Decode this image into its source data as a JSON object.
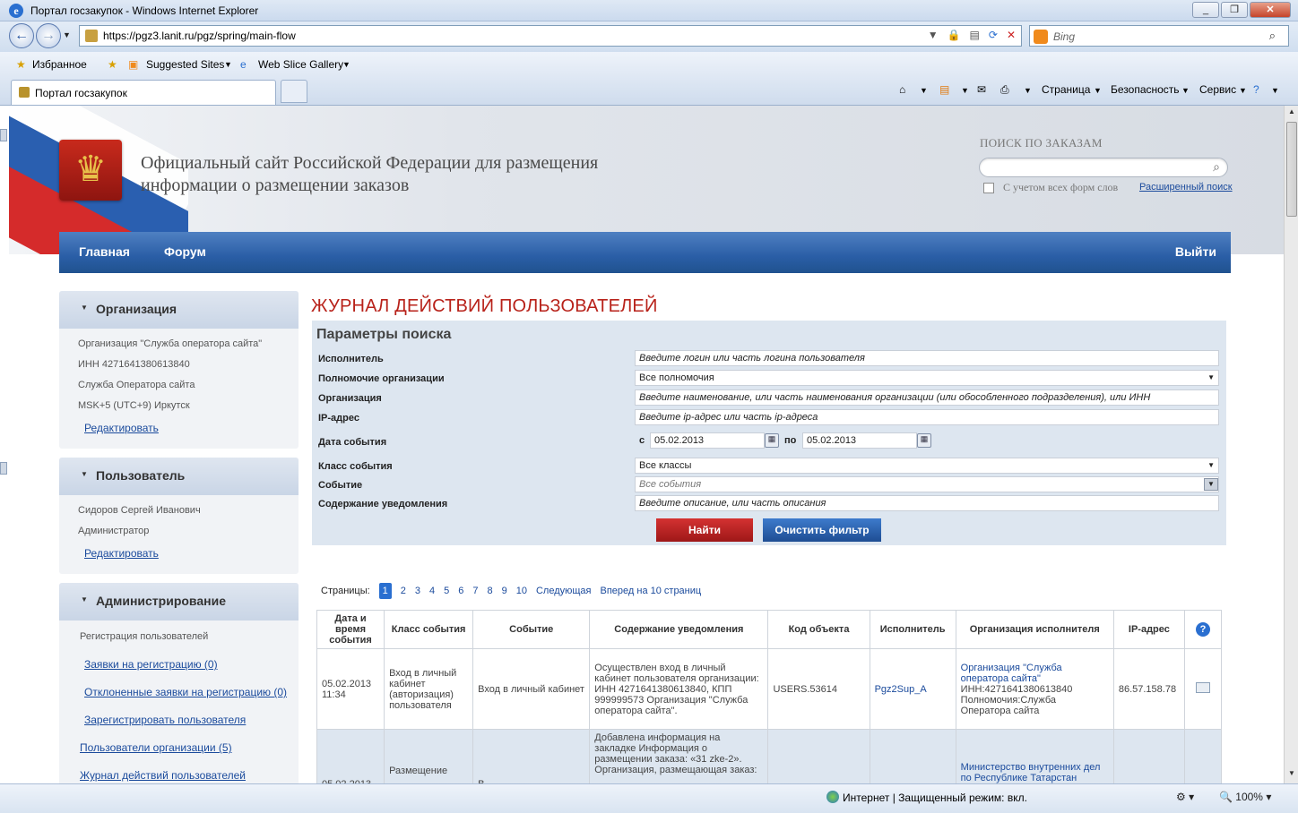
{
  "browser": {
    "window_title": "Портал госзакупок - Windows Internet Explorer",
    "url": "https://pgz3.lanit.ru/pgz/spring/main-flow",
    "search_placeholder": "Bing",
    "favorites_label": "Избранное",
    "fav_items": [
      "Suggested Sites",
      "Web Slice Gallery"
    ],
    "tab_title": "Портал госзакупок",
    "commands": [
      "Страница",
      "Безопасность",
      "Сервис"
    ],
    "status_text": "Интернет | Защищенный режим: вкл.",
    "zoom": "100%"
  },
  "site": {
    "title_line1": "Официальный сайт Российской Федерации для размещения",
    "title_line2": "информации о размещении заказов",
    "search_label": "ПОИСК ПО ЗАКАЗАМ",
    "search_checkbox_label": "С учетом всех форм слов",
    "advanced_search": "Расширенный поиск",
    "nav": {
      "home": "Главная",
      "forum": "Форум",
      "logout": "Выйти"
    }
  },
  "sidebar": {
    "org": {
      "title": "Организация",
      "lines": [
        "Организация \"Служба оператора сайта\"",
        "ИНН 4271641380613840",
        "Служба Оператора сайта",
        "MSK+5 (UTC+9) Иркутск"
      ],
      "edit": "Редактировать"
    },
    "user": {
      "title": "Пользователь",
      "lines": [
        "Сидоров Сергей Иванович",
        "Администратор"
      ],
      "edit": "Редактировать"
    },
    "admin": {
      "title": "Администрирование",
      "section": "Регистрация пользователей",
      "links": [
        "Заявки на регистрацию (0)",
        "Отклоненные заявки на регистрацию (0)",
        "Зарегистрировать пользователя"
      ],
      "links2": [
        "Пользователи организации (5)",
        "Журнал действий пользователей"
      ]
    }
  },
  "main": {
    "title": "ЖУРНАЛ ДЕЙСТВИЙ ПОЛЬЗОВАТЕЛЕЙ",
    "params_title": "Параметры поиска",
    "fields": {
      "executor": {
        "label": "Исполнитель",
        "placeholder": "Введите логин или часть логина пользователя"
      },
      "authority": {
        "label": "Полномочие организации",
        "value": "Все полномочия"
      },
      "organization": {
        "label": "Организация",
        "placeholder": "Введите наименование, или часть наименования организации (или обособленного подразделения), или ИНН"
      },
      "ip": {
        "label": "IP-адрес",
        "placeholder": "Введите ip-адрес или часть ip-адреса"
      },
      "date": {
        "label": "Дата события",
        "from_label": "с",
        "from": "05.02.2013",
        "to_label": "по",
        "to": "05.02.2013"
      },
      "event_class": {
        "label": "Класс события",
        "value": "Все классы"
      },
      "event": {
        "label": "Событие",
        "placeholder": "Все события"
      },
      "content": {
        "label": "Содержание уведомления",
        "placeholder": "Введите описание, или часть описания"
      }
    },
    "find_button": "Найти",
    "clear_button": "Очистить фильтр",
    "pager": {
      "label": "Страницы:",
      "pages": [
        "1",
        "2",
        "3",
        "4",
        "5",
        "6",
        "7",
        "8",
        "9",
        "10"
      ],
      "next": "Следующая",
      "forward": "Вперед на 10 страниц"
    },
    "table": {
      "headers": [
        "Дата и время события",
        "Класс события",
        "Событие",
        "Содержание уведомления",
        "Код объекта",
        "Исполнитель",
        "Организация исполнителя",
        "IP-адрес"
      ],
      "rows": [
        {
          "datetime": "05.02.2013 11:34",
          "class": "Вход в личный кабинет (авторизация) пользователя",
          "event": "Вход в личный кабинет",
          "content": "Осуществлен вход в личный кабинет пользователя организации: ИНН 4271641380613840, КПП 999999573 Организация \"Служба оператора сайта\".",
          "code": "USERS.53614",
          "executor": "Pgz2Sup_A",
          "org_link": "Организация \"Служба оператора сайта\"",
          "org_inn": "ИНН:4271641380613840",
          "org_auth": "Полномочия:Служба Оператора сайта",
          "ip": "86.57.158.78"
        },
        {
          "datetime": "05.02.2013",
          "class": "Размещение",
          "event": "В",
          "content": "Добавлена информация на закладке Информация о размещении заказа: «31 zke-2». Организация, размещающая заказ:",
          "code": "",
          "executor": "",
          "org_link": "Министерство внутренних дел по Республике Татарстан",
          "ip": ""
        }
      ]
    }
  }
}
